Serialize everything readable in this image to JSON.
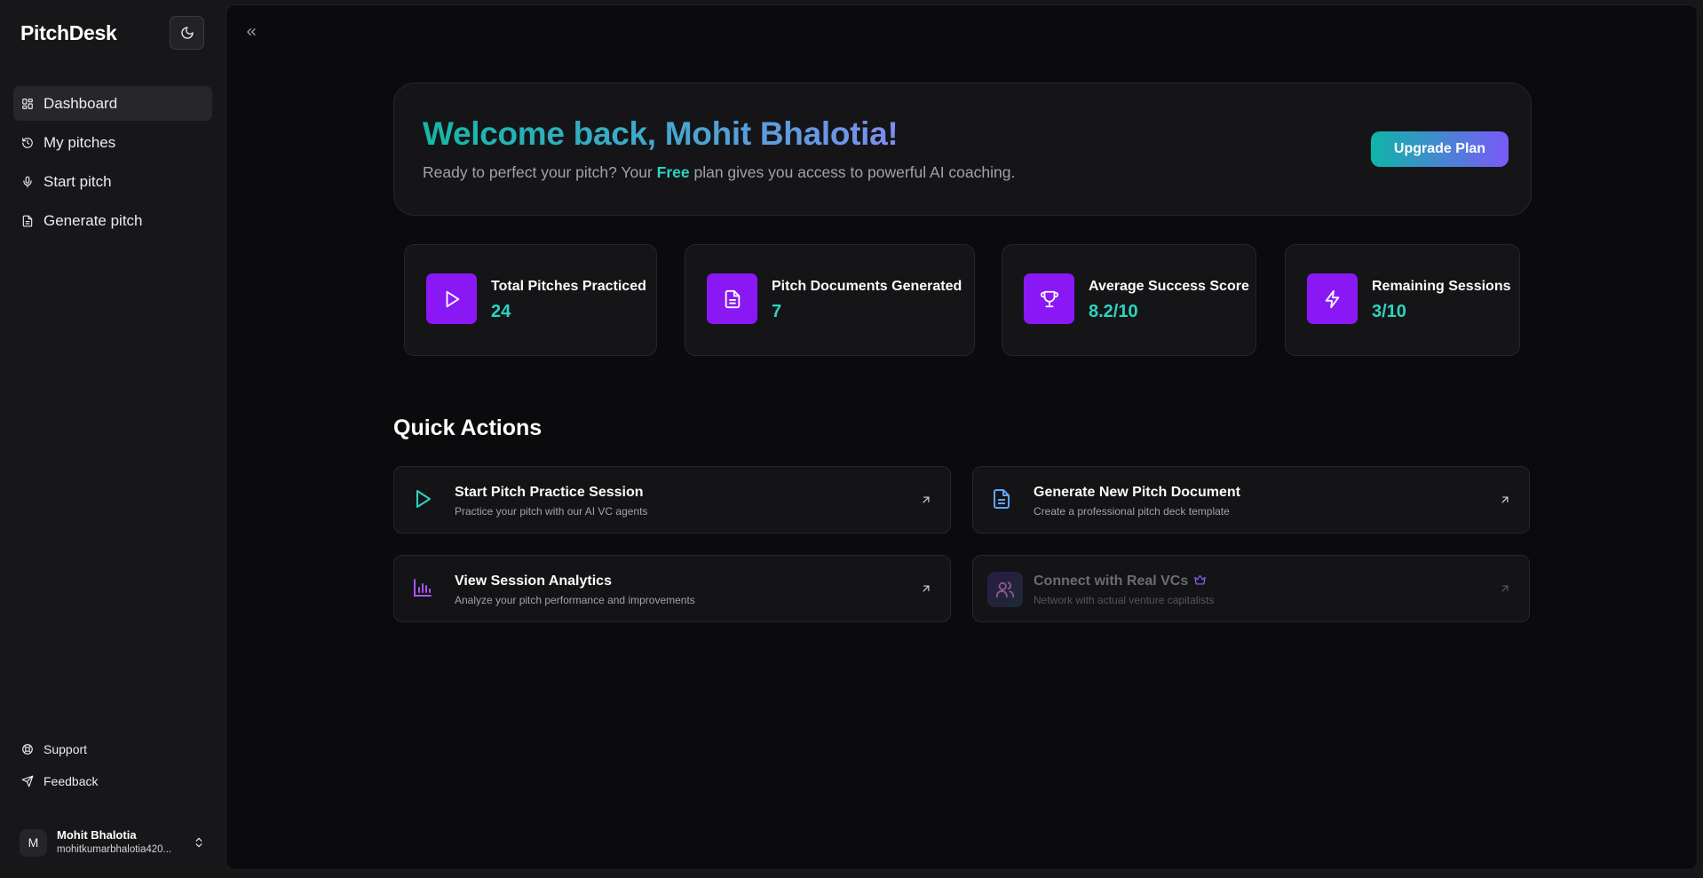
{
  "app": {
    "name": "PitchDesk"
  },
  "sidebar": {
    "items": [
      {
        "label": "Dashboard",
        "icon": "dashboard-grid-icon",
        "active": true
      },
      {
        "label": "My pitches",
        "icon": "history-icon"
      },
      {
        "label": "Start pitch",
        "icon": "microphone-icon"
      },
      {
        "label": "Generate pitch",
        "icon": "document-icon"
      }
    ],
    "footer": [
      {
        "label": "Support",
        "icon": "lifebuoy-icon"
      },
      {
        "label": "Feedback",
        "icon": "send-icon"
      }
    ],
    "user": {
      "initial": "M",
      "name": "Mohit Bhalotia",
      "email": "mohitkumarbhalotia420..."
    }
  },
  "welcome": {
    "title": "Welcome back, Mohit Bhalotia!",
    "subtitle_before": "Ready to perfect your pitch? Your ",
    "plan": "Free",
    "subtitle_after": " plan gives you access to powerful AI coaching.",
    "upgrade_label": "Upgrade Plan"
  },
  "stats": [
    {
      "label": "Total Pitches Practiced",
      "value": "24",
      "icon": "play-icon"
    },
    {
      "label": "Pitch Documents Generated",
      "value": "7",
      "icon": "document-icon"
    },
    {
      "label": "Average Success Score",
      "value": "8.2/10",
      "icon": "trophy-icon"
    },
    {
      "label": "Remaining Sessions",
      "value": "3/10",
      "icon": "lightning-icon"
    }
  ],
  "quick_actions": {
    "title": "Quick Actions",
    "items": [
      {
        "title": "Start Pitch Practice Session",
        "desc": "Practice your pitch with our AI VC agents",
        "icon": "play-icon"
      },
      {
        "title": "Generate New Pitch Document",
        "desc": "Create a professional pitch deck template",
        "icon": "document-icon"
      },
      {
        "title": "View Session Analytics",
        "desc": "Analyze your pitch performance and improvements",
        "icon": "bar-chart-icon"
      },
      {
        "title": "Connect with Real VCs",
        "desc": "Network with actual venture capitalists",
        "icon": "users-icon",
        "premium": true,
        "disabled": true
      }
    ]
  },
  "colors": {
    "accent_teal": "#2dd4bf",
    "accent_purple": "#8a18f5",
    "background": "#0b0b0d"
  }
}
